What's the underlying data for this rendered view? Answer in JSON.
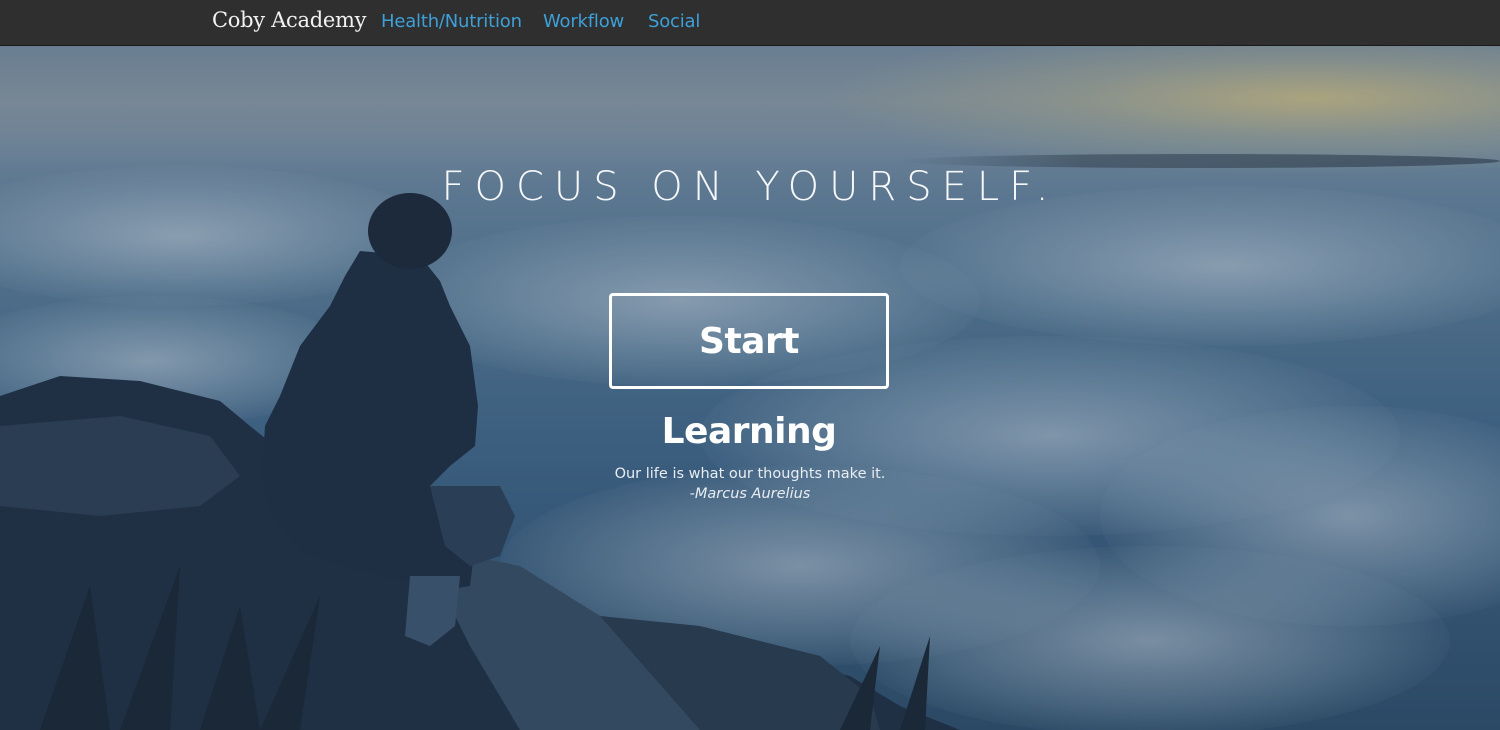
{
  "navbar": {
    "brand": "Coby Academy",
    "links": [
      "Health/Nutrition",
      "Workflow",
      "Social"
    ]
  },
  "hero": {
    "headline": "FOCUS ON YOURSELF.",
    "cta_label": "Start Learning",
    "quote_text": "Our life is what our thoughts make it.",
    "quote_author": "-Marcus Aurelius"
  },
  "colors": {
    "navbar_bg": "#2f2f2f",
    "brand_text": "#f2f2f2",
    "nav_link": "#3ea0d8",
    "hero_text": "#ffffff"
  }
}
